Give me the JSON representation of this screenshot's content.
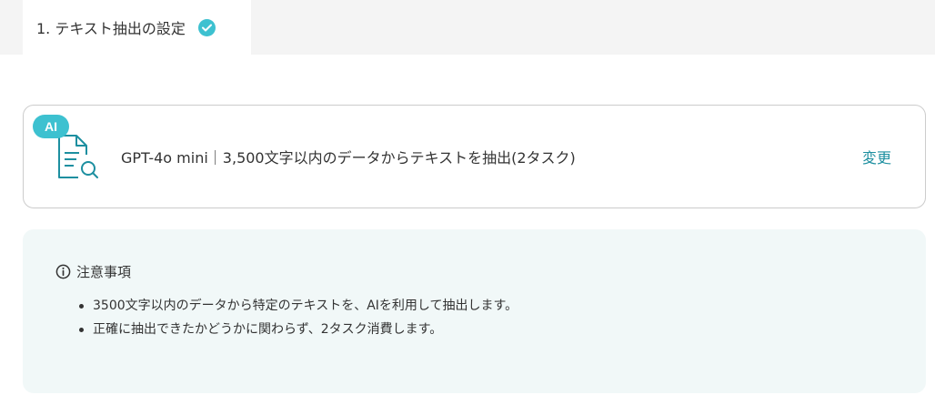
{
  "step_tab": {
    "label": "1. テキスト抽出の設定",
    "check_icon": "check-circle-icon"
  },
  "action_card": {
    "badge": "AI",
    "icon": "document-search-icon",
    "description": "GPT-4o mini｜3,500文字以内のデータからテキストを抽出(2タスク)",
    "change_label": "変更"
  },
  "notice": {
    "icon": "info-circle-icon",
    "title": "注意事項",
    "items": [
      "3500文字以内のデータから特定のテキストを、AIを利用して抽出します。",
      "正確に抽出できたかどうかに関わらず、2タスク消費します。"
    ]
  },
  "colors": {
    "accent": "#3dc1d0",
    "link": "#1d8fa0",
    "notice_bg": "#f1f8f8"
  }
}
